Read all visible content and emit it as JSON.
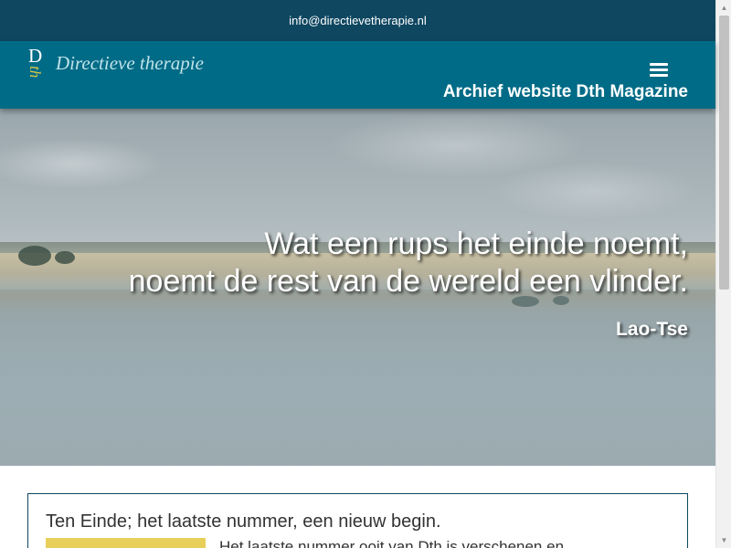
{
  "topbar": {
    "email": "info@directievetherapie.nl"
  },
  "header": {
    "logo_d": "D",
    "logo_th": "th",
    "site_name": "Directieve therapie",
    "subtitle": "Archief website Dth Magazine",
    "menu_icon": "hamburger-menu-icon"
  },
  "hero": {
    "quote_line1": "Wat een rups het einde noemt,",
    "quote_line2": "noemt de rest van de wereld een vlinder.",
    "author": "Lao-Tse"
  },
  "article": {
    "title": "Ten Einde; het laatste nummer, een nieuw begin.",
    "intro": "Het laatste nummer ooit van Dth is verschenen en"
  },
  "colors": {
    "topbar": "#0f4761",
    "navbar": "#006b86",
    "logo_name": "#bfe3ea",
    "logo_accent": "#d8c84a",
    "card_image": "#e8cf5a"
  }
}
